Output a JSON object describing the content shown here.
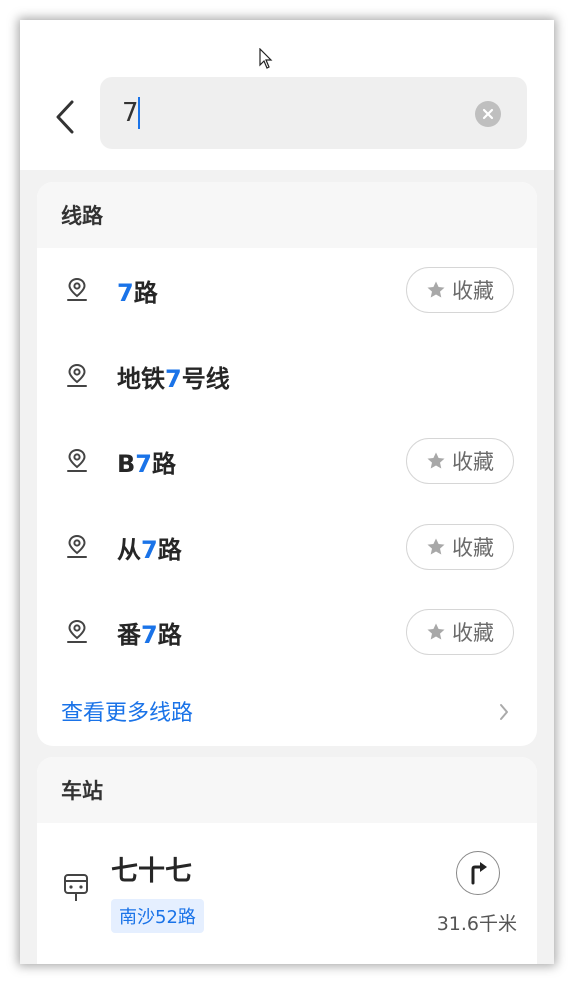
{
  "search": {
    "value": "7"
  },
  "routes_section": {
    "title": "线路",
    "items": [
      {
        "prefix": "",
        "highlight": "7",
        "suffix": "路",
        "favorite_label": "收藏",
        "show_favorite": true
      },
      {
        "prefix": "地铁",
        "highlight": "7",
        "suffix": "号线",
        "favorite_label": "",
        "show_favorite": false
      },
      {
        "prefix": "B",
        "highlight": "7",
        "suffix": "路",
        "favorite_label": "收藏",
        "show_favorite": true
      },
      {
        "prefix": "从",
        "highlight": "7",
        "suffix": "路",
        "favorite_label": "收藏",
        "show_favorite": true
      },
      {
        "prefix": "番",
        "highlight": "7",
        "suffix": "路",
        "favorite_label": "收藏",
        "show_favorite": true
      }
    ],
    "more_label": "查看更多线路"
  },
  "stations_section": {
    "title": "车站",
    "station": {
      "name": "七十七",
      "line_badge": "南沙52路",
      "distance": "31.6千米"
    }
  },
  "icons": {
    "back": "chevron-left-icon",
    "clear": "close-circle-icon",
    "route": "route-pin-icon",
    "favorite": "star-icon",
    "more": "chevron-right-icon",
    "station": "bus-stop-icon",
    "navigate": "navigate-turn-icon"
  },
  "colors": {
    "accent": "#1a73e8",
    "badge_bg": "#e5efff",
    "background": "#f2f2f2"
  }
}
